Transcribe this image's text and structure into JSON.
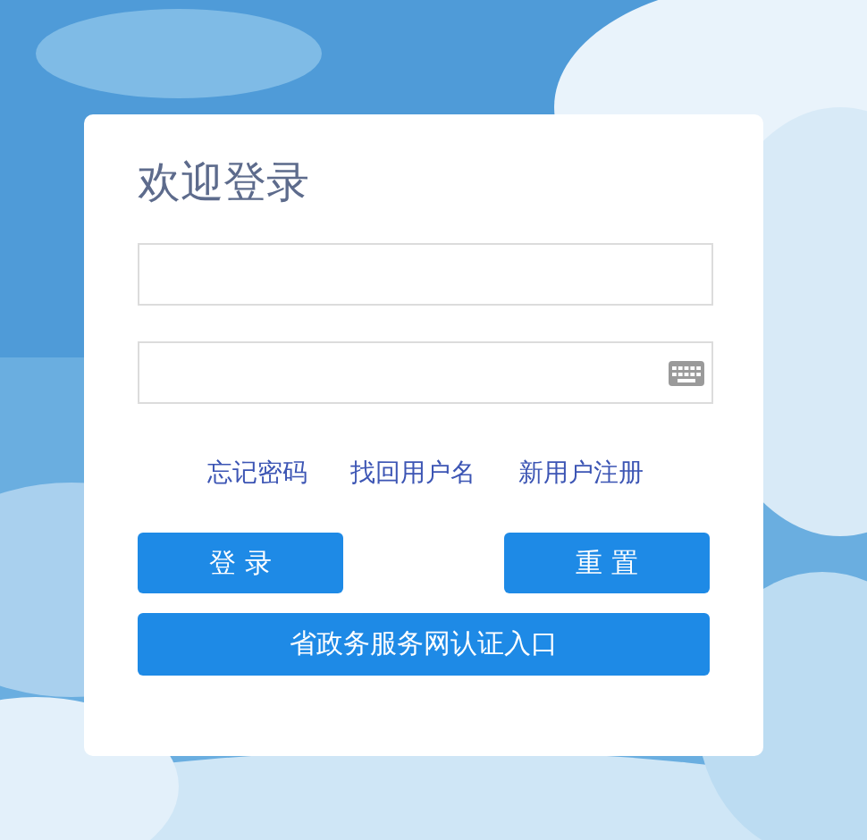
{
  "login": {
    "title": "欢迎登录",
    "fields": [
      {
        "kind": "text"
      },
      {
        "kind": "password"
      }
    ],
    "links": [
      "忘记密码",
      "找回用户名",
      "新用户注册"
    ],
    "buttons": [
      "登 录",
      "重 置"
    ],
    "portal_button": "省政务服务网认证入口"
  }
}
